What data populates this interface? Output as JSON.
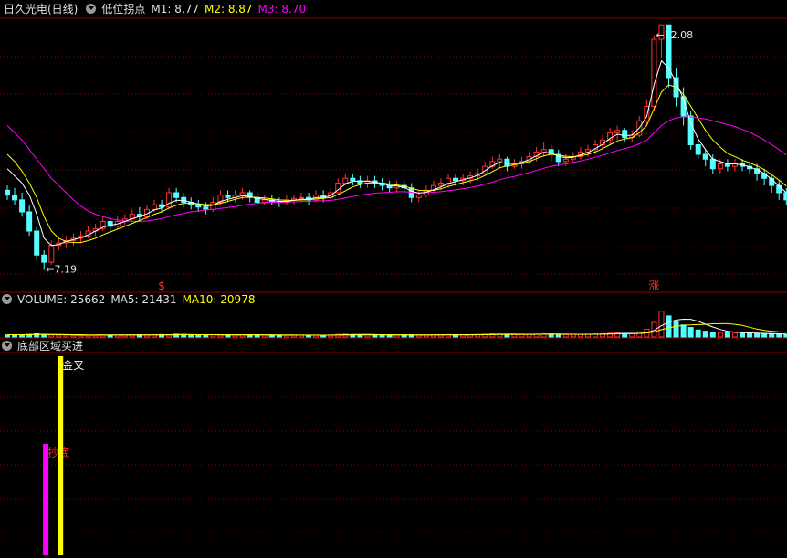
{
  "main_header": {
    "stock_name": "日久光电(日线)",
    "indicator_name": "低位拐点",
    "m1_label": "M1:",
    "m1_value": "8.77",
    "m2_label": "M2:",
    "m2_value": "8.87",
    "m3_label": "M3:",
    "m3_value": "8.70"
  },
  "volume_header": {
    "volume_label": "VOLUME:",
    "volume_value": "25662",
    "ma5_label": "MA5:",
    "ma5_value": "21431",
    "ma10_label": "MA10:",
    "ma10_value": "20978"
  },
  "signal_header": {
    "title": "底部区域买进"
  },
  "colors": {
    "up": "#ff3232",
    "down": "#54ffff",
    "m1": "#ffffff",
    "m2": "#ffff00",
    "m3": "#ff00ff",
    "grid": "#8b0000",
    "text_white": "#e0e0e0",
    "signal_magenta": "#ff00ff",
    "signal_yellow": "#ffff00"
  },
  "chart_data": [
    {
      "type": "candlestick",
      "panel": "price",
      "ylim": [
        6.8,
        12.4
      ],
      "grid": true,
      "opens": [
        8.85,
        8.75,
        8.65,
        8.4,
        8.0,
        7.5,
        7.35,
        7.7,
        7.75,
        7.8,
        7.85,
        7.9,
        8.0,
        8.05,
        8.2,
        8.1,
        8.2,
        8.25,
        8.35,
        8.3,
        8.45,
        8.55,
        8.5,
        8.8,
        8.7,
        8.6,
        8.55,
        8.5,
        8.45,
        8.6,
        8.75,
        8.7,
        8.75,
        8.8,
        8.7,
        8.6,
        8.65,
        8.62,
        8.6,
        8.65,
        8.68,
        8.7,
        8.65,
        8.75,
        8.7,
        8.8,
        9.0,
        9.1,
        9.05,
        9.0,
        9.05,
        9.0,
        8.95,
        8.9,
        8.95,
        8.9,
        8.7,
        8.75,
        8.85,
        8.95,
        9.0,
        9.1,
        9.05,
        9.1,
        9.15,
        9.2,
        9.35,
        9.45,
        9.5,
        9.35,
        9.4,
        9.45,
        9.55,
        9.65,
        9.7,
        9.6,
        9.45,
        9.5,
        9.55,
        9.65,
        9.7,
        9.8,
        9.9,
        10.05,
        10.1,
        9.95,
        10.0,
        10.3,
        10.6,
        12.0,
        12.3,
        11.2,
        10.8,
        10.4,
        9.8,
        9.6,
        9.5,
        9.3,
        9.4,
        9.35,
        9.4,
        9.35,
        9.3,
        9.2,
        9.1,
        8.95,
        8.8
      ],
      "closes": [
        8.75,
        8.65,
        8.4,
        8.0,
        7.5,
        7.35,
        7.7,
        7.75,
        7.8,
        7.85,
        7.9,
        8.0,
        8.05,
        8.2,
        8.1,
        8.2,
        8.25,
        8.35,
        8.3,
        8.45,
        8.55,
        8.5,
        8.8,
        8.7,
        8.6,
        8.55,
        8.5,
        8.45,
        8.6,
        8.75,
        8.7,
        8.75,
        8.8,
        8.7,
        8.6,
        8.65,
        8.62,
        8.6,
        8.65,
        8.68,
        8.7,
        8.65,
        8.75,
        8.7,
        8.8,
        9.0,
        9.1,
        9.05,
        9.0,
        9.05,
        9.0,
        8.95,
        8.9,
        8.95,
        8.9,
        8.7,
        8.75,
        8.85,
        8.95,
        9.0,
        9.1,
        9.05,
        9.1,
        9.15,
        9.2,
        9.35,
        9.45,
        9.5,
        9.35,
        9.4,
        9.45,
        9.55,
        9.65,
        9.7,
        9.6,
        9.45,
        9.5,
        9.55,
        9.65,
        9.7,
        9.8,
        9.9,
        10.05,
        10.1,
        9.95,
        10.0,
        10.3,
        10.6,
        12.0,
        12.3,
        11.2,
        10.8,
        10.4,
        9.8,
        9.6,
        9.5,
        9.3,
        9.4,
        9.35,
        9.4,
        9.35,
        9.3,
        9.2,
        9.1,
        8.95,
        8.8,
        8.65
      ],
      "highs": [
        8.95,
        8.9,
        8.8,
        8.55,
        8.1,
        7.6,
        7.8,
        7.85,
        7.9,
        7.95,
        8.0,
        8.1,
        8.15,
        8.3,
        8.3,
        8.3,
        8.35,
        8.45,
        8.5,
        8.55,
        8.65,
        8.65,
        8.9,
        8.9,
        8.8,
        8.7,
        8.65,
        8.6,
        8.7,
        8.85,
        8.85,
        8.85,
        8.9,
        8.85,
        8.8,
        8.75,
        8.75,
        8.7,
        8.75,
        8.75,
        8.8,
        8.8,
        8.85,
        8.85,
        8.9,
        9.1,
        9.2,
        9.2,
        9.15,
        9.15,
        9.15,
        9.1,
        9.05,
        9.05,
        9.05,
        9.0,
        8.85,
        8.95,
        9.05,
        9.1,
        9.2,
        9.2,
        9.2,
        9.25,
        9.3,
        9.45,
        9.55,
        9.6,
        9.55,
        9.5,
        9.55,
        9.65,
        9.75,
        9.85,
        9.8,
        9.7,
        9.6,
        9.65,
        9.75,
        9.8,
        9.9,
        10.0,
        10.15,
        10.2,
        10.15,
        10.1,
        10.4,
        10.75,
        12.08,
        12.3,
        12.3,
        11.4,
        11.0,
        10.5,
        9.9,
        9.7,
        9.6,
        9.5,
        9.5,
        9.5,
        9.5,
        9.45,
        9.4,
        9.3,
        9.2,
        9.05,
        8.9
      ],
      "lows": [
        8.65,
        8.55,
        8.3,
        7.9,
        7.4,
        7.19,
        7.3,
        7.6,
        7.65,
        7.7,
        7.75,
        7.85,
        7.9,
        8.0,
        8.0,
        8.05,
        8.1,
        8.2,
        8.2,
        8.25,
        8.4,
        8.4,
        8.45,
        8.6,
        8.5,
        8.45,
        8.4,
        8.35,
        8.4,
        8.55,
        8.6,
        8.6,
        8.65,
        8.6,
        8.5,
        8.55,
        8.55,
        8.5,
        8.55,
        8.55,
        8.6,
        8.55,
        8.6,
        8.6,
        8.65,
        8.75,
        8.95,
        8.95,
        8.9,
        8.9,
        8.9,
        8.85,
        8.8,
        8.8,
        8.8,
        8.6,
        8.6,
        8.7,
        8.8,
        8.85,
        8.9,
        8.95,
        8.95,
        9.0,
        9.05,
        9.15,
        9.3,
        9.3,
        9.25,
        9.3,
        9.3,
        9.4,
        9.45,
        9.55,
        9.45,
        9.35,
        9.35,
        9.4,
        9.5,
        9.55,
        9.6,
        9.7,
        9.8,
        9.9,
        9.85,
        9.85,
        9.95,
        10.2,
        10.5,
        11.6,
        11.0,
        10.6,
        10.2,
        9.7,
        9.5,
        9.35,
        9.2,
        9.2,
        9.25,
        9.25,
        9.25,
        9.2,
        9.05,
        8.95,
        8.8,
        8.65,
        8.55
      ],
      "m1": [
        9.3,
        9.15,
        9.0,
        8.75,
        8.35,
        7.85,
        7.7,
        7.72,
        7.78,
        7.82,
        7.86,
        7.92,
        8.0,
        8.08,
        8.12,
        8.15,
        8.2,
        8.26,
        8.3,
        8.36,
        8.44,
        8.48,
        8.58,
        8.64,
        8.64,
        8.6,
        8.56,
        8.52,
        8.54,
        8.62,
        8.66,
        8.7,
        8.74,
        8.72,
        8.68,
        8.66,
        8.64,
        8.62,
        8.62,
        8.64,
        8.66,
        8.66,
        8.7,
        8.7,
        8.74,
        8.86,
        8.98,
        9.04,
        9.04,
        9.04,
        9.02,
        8.99,
        8.95,
        8.94,
        8.91,
        8.83,
        8.79,
        8.81,
        8.86,
        8.92,
        8.99,
        9.03,
        9.07,
        9.11,
        9.16,
        9.26,
        9.36,
        9.43,
        9.41,
        9.41,
        9.43,
        9.49,
        9.57,
        9.64,
        9.63,
        9.56,
        9.53,
        9.54,
        9.59,
        9.64,
        9.72,
        9.81,
        9.93,
        10.02,
        9.99,
        10.0,
        10.15,
        10.39,
        11.05,
        11.55,
        11.4,
        11.1,
        10.75,
        10.25,
        9.92,
        9.7,
        9.5,
        9.45,
        9.4,
        9.4,
        9.38,
        9.34,
        9.28,
        9.2,
        9.08,
        8.94,
        8.8
      ],
      "m2": [
        9.6,
        9.45,
        9.25,
        9.0,
        8.7,
        8.3,
        8.0,
        7.85,
        7.78,
        7.76,
        7.76,
        7.8,
        7.85,
        7.92,
        7.98,
        8.04,
        8.1,
        8.16,
        8.22,
        8.28,
        8.35,
        8.4,
        8.48,
        8.54,
        8.58,
        8.58,
        8.57,
        8.55,
        8.55,
        8.58,
        8.62,
        8.66,
        8.7,
        8.71,
        8.7,
        8.69,
        8.67,
        8.65,
        8.64,
        8.64,
        8.65,
        8.65,
        8.67,
        8.68,
        8.7,
        8.76,
        8.84,
        8.92,
        8.97,
        9.0,
        9.01,
        9.0,
        8.98,
        8.96,
        8.94,
        8.89,
        8.85,
        8.84,
        8.85,
        8.88,
        8.93,
        8.97,
        9.01,
        9.05,
        9.09,
        9.16,
        9.24,
        9.32,
        9.36,
        9.38,
        9.41,
        9.45,
        9.51,
        9.57,
        9.6,
        9.58,
        9.56,
        9.55,
        9.57,
        9.6,
        9.65,
        9.72,
        9.8,
        9.88,
        9.92,
        9.95,
        10.05,
        10.2,
        10.55,
        10.9,
        11.05,
        11.0,
        10.85,
        10.6,
        10.35,
        10.1,
        9.9,
        9.75,
        9.62,
        9.55,
        9.48,
        9.42,
        9.36,
        9.28,
        9.18,
        9.06,
        8.94
      ],
      "m3": [
        10.2,
        10.05,
        9.9,
        9.7,
        9.5,
        9.3,
        9.1,
        8.95,
        8.8,
        8.65,
        8.52,
        8.42,
        8.35,
        8.3,
        8.26,
        8.23,
        8.21,
        8.2,
        8.2,
        8.21,
        8.23,
        8.26,
        8.3,
        8.34,
        8.37,
        8.4,
        8.42,
        8.44,
        8.45,
        8.47,
        8.49,
        8.51,
        8.54,
        8.56,
        8.58,
        8.59,
        8.6,
        8.6,
        8.61,
        8.61,
        8.62,
        8.62,
        8.63,
        8.63,
        8.64,
        8.66,
        8.69,
        8.72,
        8.75,
        8.77,
        8.79,
        8.8,
        8.81,
        8.82,
        8.82,
        8.81,
        8.8,
        8.8,
        8.81,
        8.82,
        8.84,
        8.86,
        8.88,
        8.91,
        8.94,
        8.98,
        9.02,
        9.07,
        9.11,
        9.14,
        9.18,
        9.22,
        9.26,
        9.31,
        9.35,
        9.38,
        9.4,
        9.43,
        9.46,
        9.5,
        9.54,
        9.58,
        9.63,
        9.68,
        9.72,
        9.76,
        9.82,
        9.9,
        10.05,
        10.2,
        10.3,
        10.36,
        10.38,
        10.38,
        10.36,
        10.34,
        10.3,
        10.26,
        10.22,
        10.18,
        10.12,
        10.06,
        9.98,
        9.9,
        9.8,
        9.7,
        9.58
      ],
      "annotations": [
        {
          "label": "7.19",
          "index": 5,
          "price": 7.19,
          "position": "below"
        },
        {
          "label": "12.08",
          "index": 88,
          "price": 12.08,
          "position": "above"
        }
      ],
      "markers": [
        {
          "label": "$",
          "index": 21,
          "color": "#ff3232"
        },
        {
          "label": "涨",
          "index": 88,
          "color": "#ff3232"
        }
      ]
    },
    {
      "type": "bar",
      "panel": "volume",
      "ylim": [
        0,
        30000
      ],
      "values": [
        2100,
        2300,
        2200,
        2600,
        3200,
        2400,
        2100,
        1900,
        1800,
        1700,
        1800,
        1900,
        2000,
        2100,
        2000,
        1900,
        2000,
        2100,
        2200,
        2000,
        2300,
        2400,
        2200,
        2800,
        2500,
        2100,
        1900,
        1800,
        2000,
        2300,
        2200,
        2100,
        2200,
        2100,
        1900,
        1800,
        1900,
        1800,
        1700,
        1800,
        1900,
        1800,
        1900,
        1800,
        2000,
        2600,
        2900,
        2400,
        2200,
        2100,
        2000,
        1900,
        1800,
        1800,
        1700,
        2200,
        2000,
        1900,
        2100,
        2200,
        2400,
        2300,
        2200,
        2300,
        2400,
        2800,
        3200,
        3000,
        2600,
        2400,
        2500,
        2700,
        3000,
        3300,
        2900,
        2600,
        2400,
        2500,
        2700,
        2800,
        3100,
        3300,
        3800,
        4200,
        3600,
        3500,
        5200,
        7800,
        14500,
        25662,
        21000,
        15500,
        12000,
        9500,
        7000,
        5800,
        5000,
        4500,
        4200,
        3900,
        3700,
        3600,
        3300,
        3000,
        2800,
        2700,
        2500
      ],
      "ma5": [
        2300,
        2280,
        2260,
        2400,
        2600,
        2640,
        2500,
        2440,
        2280,
        1980,
        1860,
        1820,
        1840,
        1900,
        1940,
        1980,
        1980,
        2000,
        2040,
        2040,
        2120,
        2200,
        2220,
        2340,
        2440,
        2400,
        2300,
        2260,
        2240,
        2120,
        2040,
        2040,
        2120,
        2160,
        2140,
        2060,
        2020,
        1940,
        1820,
        1780,
        1820,
        1800,
        1820,
        1840,
        1880,
        2020,
        2240,
        2340,
        2420,
        2440,
        2320,
        2200,
        2080,
        2040,
        1960,
        1880,
        1880,
        1920,
        1980,
        2080,
        2160,
        2180,
        2240,
        2280,
        2320,
        2400,
        2580,
        2740,
        2800,
        2800,
        2700,
        2640,
        2640,
        2780,
        2880,
        2900,
        2840,
        2740,
        2620,
        2600,
        2700,
        2860,
        3140,
        3440,
        3600,
        3680,
        3660,
        4460,
        6460,
        11340,
        14812,
        16892,
        17732,
        17592,
        15600,
        12760,
        9960,
        7560,
        5760,
        4880,
        4380,
        4100,
        3820,
        3580,
        3360,
        3160,
        2940
      ],
      "ma10": [
        2300,
        2290,
        2280,
        2350,
        2450,
        2470,
        2400,
        2370,
        2320,
        2290,
        2250,
        2130,
        2050,
        1970,
        1900,
        1890,
        1900,
        1920,
        1970,
        1990,
        2030,
        2080,
        2110,
        2180,
        2220,
        2260,
        2250,
        2240,
        2230,
        2190,
        2170,
        2170,
        2150,
        2150,
        2150,
        2130,
        2100,
        2030,
        1980,
        1970,
        1940,
        1910,
        1880,
        1840,
        1830,
        1890,
        1950,
        2010,
        2030,
        2060,
        2120,
        2180,
        2180,
        2180,
        2170,
        2130,
        2060,
        2010,
        2010,
        2020,
        2020,
        2030,
        2080,
        2130,
        2180,
        2230,
        2340,
        2420,
        2470,
        2500,
        2550,
        2610,
        2690,
        2770,
        2810,
        2760,
        2720,
        2690,
        2730,
        2750,
        2790,
        2850,
        2950,
        3080,
        3160,
        3270,
        3540,
        4040,
        5040,
        7350,
        9060,
        10770,
        11730,
        12110,
        12340,
        12640,
        13160,
        13270,
        13290,
        12610,
        11540,
        9700,
        7920,
        6630,
        5860,
        5290,
        4910
      ]
    },
    {
      "type": "bar",
      "panel": "signal",
      "ylim": [
        0,
        100
      ],
      "bars": [
        {
          "index": 2,
          "value": 56,
          "color": "#ff00ff",
          "label": "抄底",
          "label_color": "#ff2020"
        },
        {
          "index": 4,
          "value": 100,
          "color": "#ffff00",
          "label": "金叉",
          "label_color": "#ffffff"
        }
      ]
    }
  ]
}
